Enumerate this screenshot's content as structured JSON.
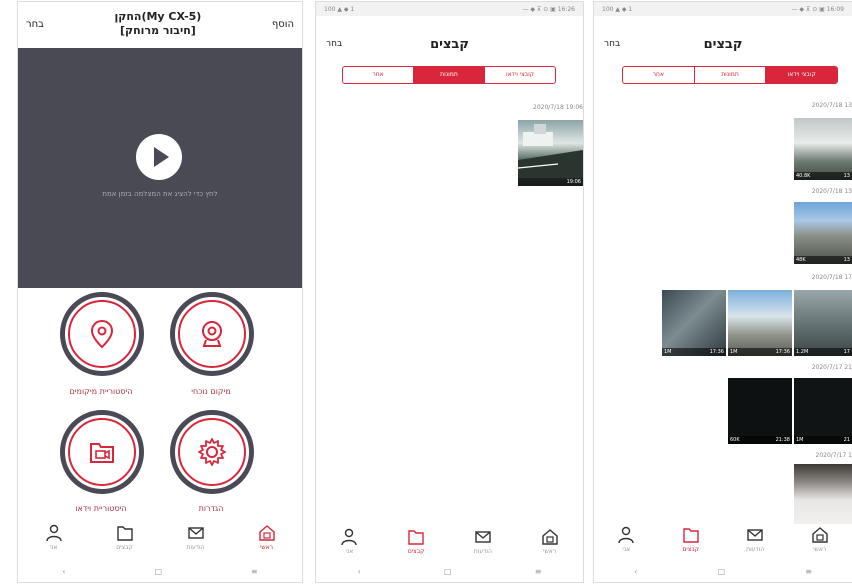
{
  "colors": {
    "accent": "#d9263a",
    "video_bg": "#4a4a55",
    "ring": "#4a4a55"
  },
  "phone1": {
    "header": {
      "left": "בחר",
      "right": "הוסף",
      "title_line1": "החקן(My CX-5)",
      "title_line2": "[חיבור מרוחק]"
    },
    "video_hint": "לחץ כדי להציג את המצלמה בזמן אמת",
    "features": [
      {
        "icon": "map-pin-icon",
        "label": "היסטוריית מיקומים"
      },
      {
        "icon": "dashcam-icon",
        "label": "מיקום נוכחי"
      },
      {
        "icon": "video-folder-icon",
        "label": "היסטוריית וידאו"
      },
      {
        "icon": "gear-icon",
        "label": "הגדרות"
      }
    ],
    "nav": [
      {
        "icon": "person-icon",
        "label": "אני"
      },
      {
        "icon": "folder-icon",
        "label": "קבצים"
      },
      {
        "icon": "mail-icon",
        "label": "הודעות"
      },
      {
        "icon": "home-icon",
        "label": "ראשי"
      }
    ],
    "sys_nav": [
      "‹",
      "□",
      "≡"
    ]
  },
  "phone2": {
    "status_left": "100 ▲ ◆ 1",
    "status_right": "— ◆ ⊼ ⊙ ▣ 16:26",
    "title": "קבצים",
    "select": "בחר",
    "tabs": [
      "אחר",
      "תמונות",
      "קובצי וידאו"
    ],
    "active_tab": 1,
    "date": "2020/7/18 19:06",
    "thumb_times": [
      "19:06"
    ],
    "nav": [
      {
        "icon": "person-icon",
        "label": "אני"
      },
      {
        "icon": "folder-icon",
        "label": "קבצים"
      },
      {
        "icon": "mail-icon",
        "label": "הודעות"
      },
      {
        "icon": "home-icon",
        "label": "ראשי"
      }
    ],
    "sys_nav": [
      "‹",
      "□",
      "≡"
    ]
  },
  "phone3": {
    "status_left": "100 ▲ ◆ 1",
    "status_right": "— ◆ ⊼ ⊙ ▣ 16:09",
    "title": "קבצים",
    "select": "בחר",
    "tabs": [
      "אחר",
      "תמונות",
      "קובצי וידאו"
    ],
    "active_tab": 2,
    "dates": [
      "2020/7/18 13",
      "2020/7/18 13",
      "2020/7/18 17",
      "2020/7/17 21",
      "2020/7/17 1"
    ],
    "thumb_labels": [
      "40.8K",
      "48K",
      "1M",
      "1M",
      "1.2M",
      "60K",
      "1M"
    ],
    "thumb_times": [
      "13",
      "13",
      "17:36",
      "17:36",
      "17",
      "21:38",
      "21"
    ],
    "nav": [
      {
        "icon": "person-icon",
        "label": "אני"
      },
      {
        "icon": "folder-icon",
        "label": "קבצים"
      },
      {
        "icon": "mail-icon",
        "label": "הודעות"
      },
      {
        "icon": "home-icon",
        "label": "ראשי"
      }
    ],
    "sys_nav": [
      "‹",
      "□",
      "≡"
    ]
  }
}
